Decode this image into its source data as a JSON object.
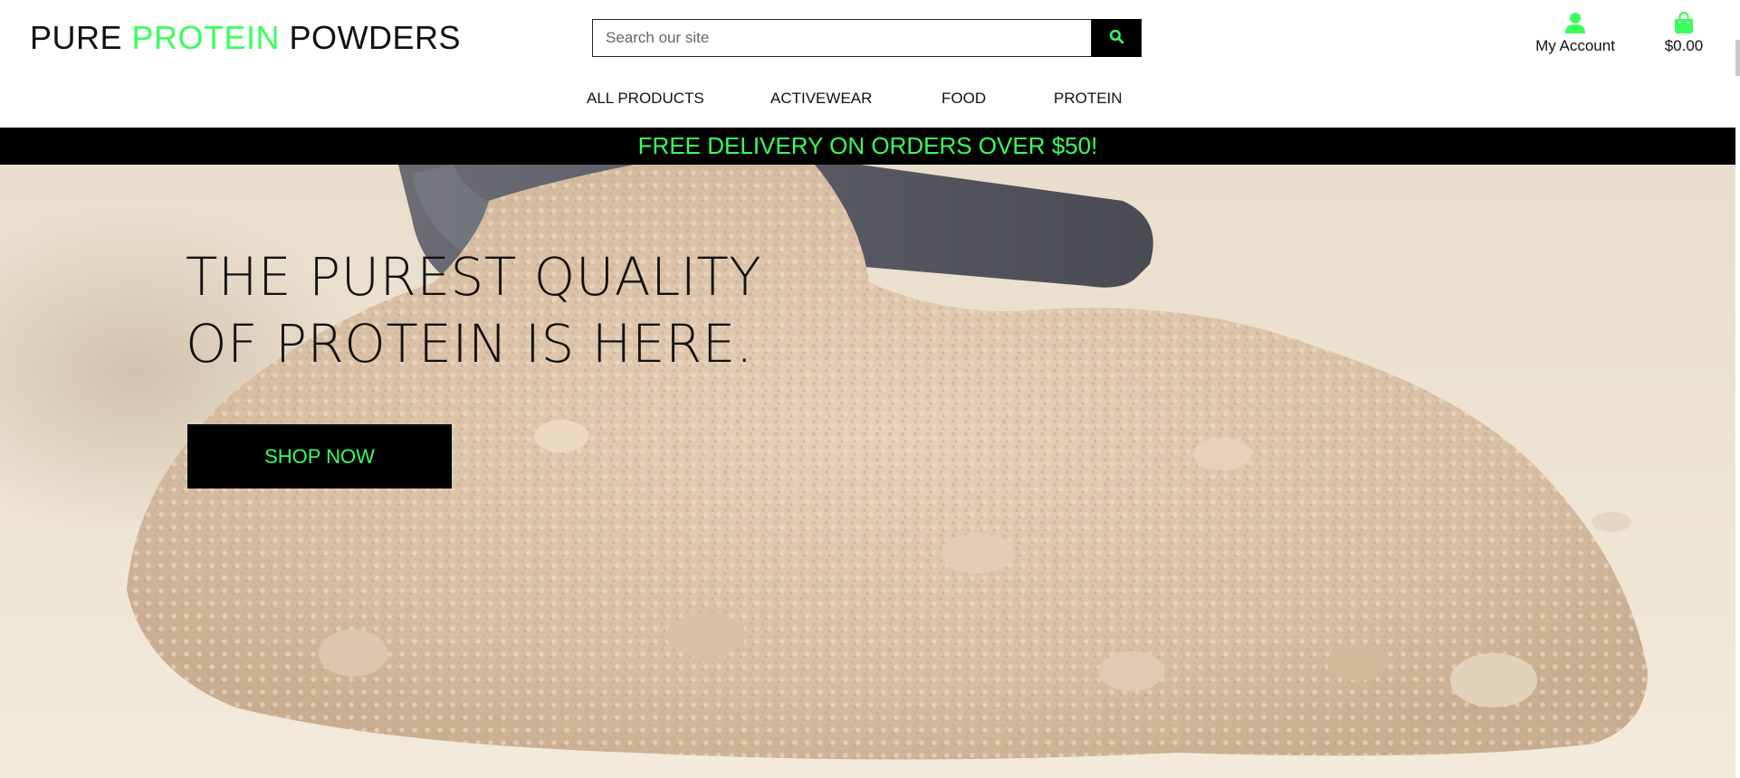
{
  "brand": {
    "part1": "PURE ",
    "part2": "PROTEIN",
    "part3": " POWDERS"
  },
  "search": {
    "placeholder": "Search our site",
    "value": "",
    "button_icon": "search-icon"
  },
  "nav": {
    "items": [
      {
        "label": "ALL PRODUCTS"
      },
      {
        "label": "ACTIVEWEAR"
      },
      {
        "label": "FOOD"
      },
      {
        "label": "PROTEIN"
      }
    ]
  },
  "account": {
    "icon": "user-icon",
    "label": "My Account"
  },
  "cart": {
    "icon": "shopping-bag-icon",
    "total": "$0.00"
  },
  "promo": {
    "text": "FREE DELIVERY ON ORDERS OVER $50!"
  },
  "hero": {
    "heading_line1": "THE PUREST QUALITY",
    "heading_line2": "OF PROTEIN IS HERE.",
    "cta_label": "SHOP NOW"
  },
  "colors": {
    "accent": "#39ff5a",
    "dark": "#000000",
    "hero_background": "#efe4d2",
    "powder": "#d9c2a8",
    "scoop": "#5a5b64"
  }
}
